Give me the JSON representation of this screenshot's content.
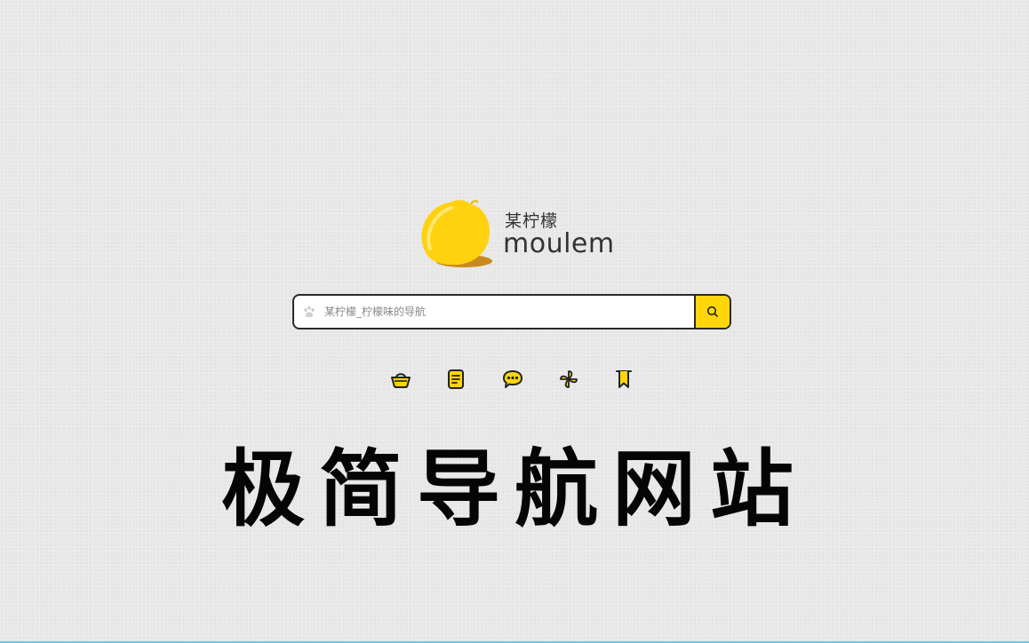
{
  "logo": {
    "cn_name": "某柠檬",
    "en_name": "moulem",
    "icon": "lemon-logo-icon"
  },
  "search": {
    "placeholder": "某柠檬_柠檬味的导航",
    "value": "",
    "engine_icon": "paw-icon",
    "button_icon": "search-icon"
  },
  "quick_links": [
    {
      "icon": "basket-icon"
    },
    {
      "icon": "notepad-icon"
    },
    {
      "icon": "chat-bubble-icon"
    },
    {
      "icon": "pinwheel-icon"
    },
    {
      "icon": "bookmark-icon"
    }
  ],
  "caption": "极简导航网站",
  "colors": {
    "accent": "#ffd60a",
    "border": "#2a2a2a",
    "background": "#e9e9e9",
    "lemon": "#ffd10f"
  }
}
